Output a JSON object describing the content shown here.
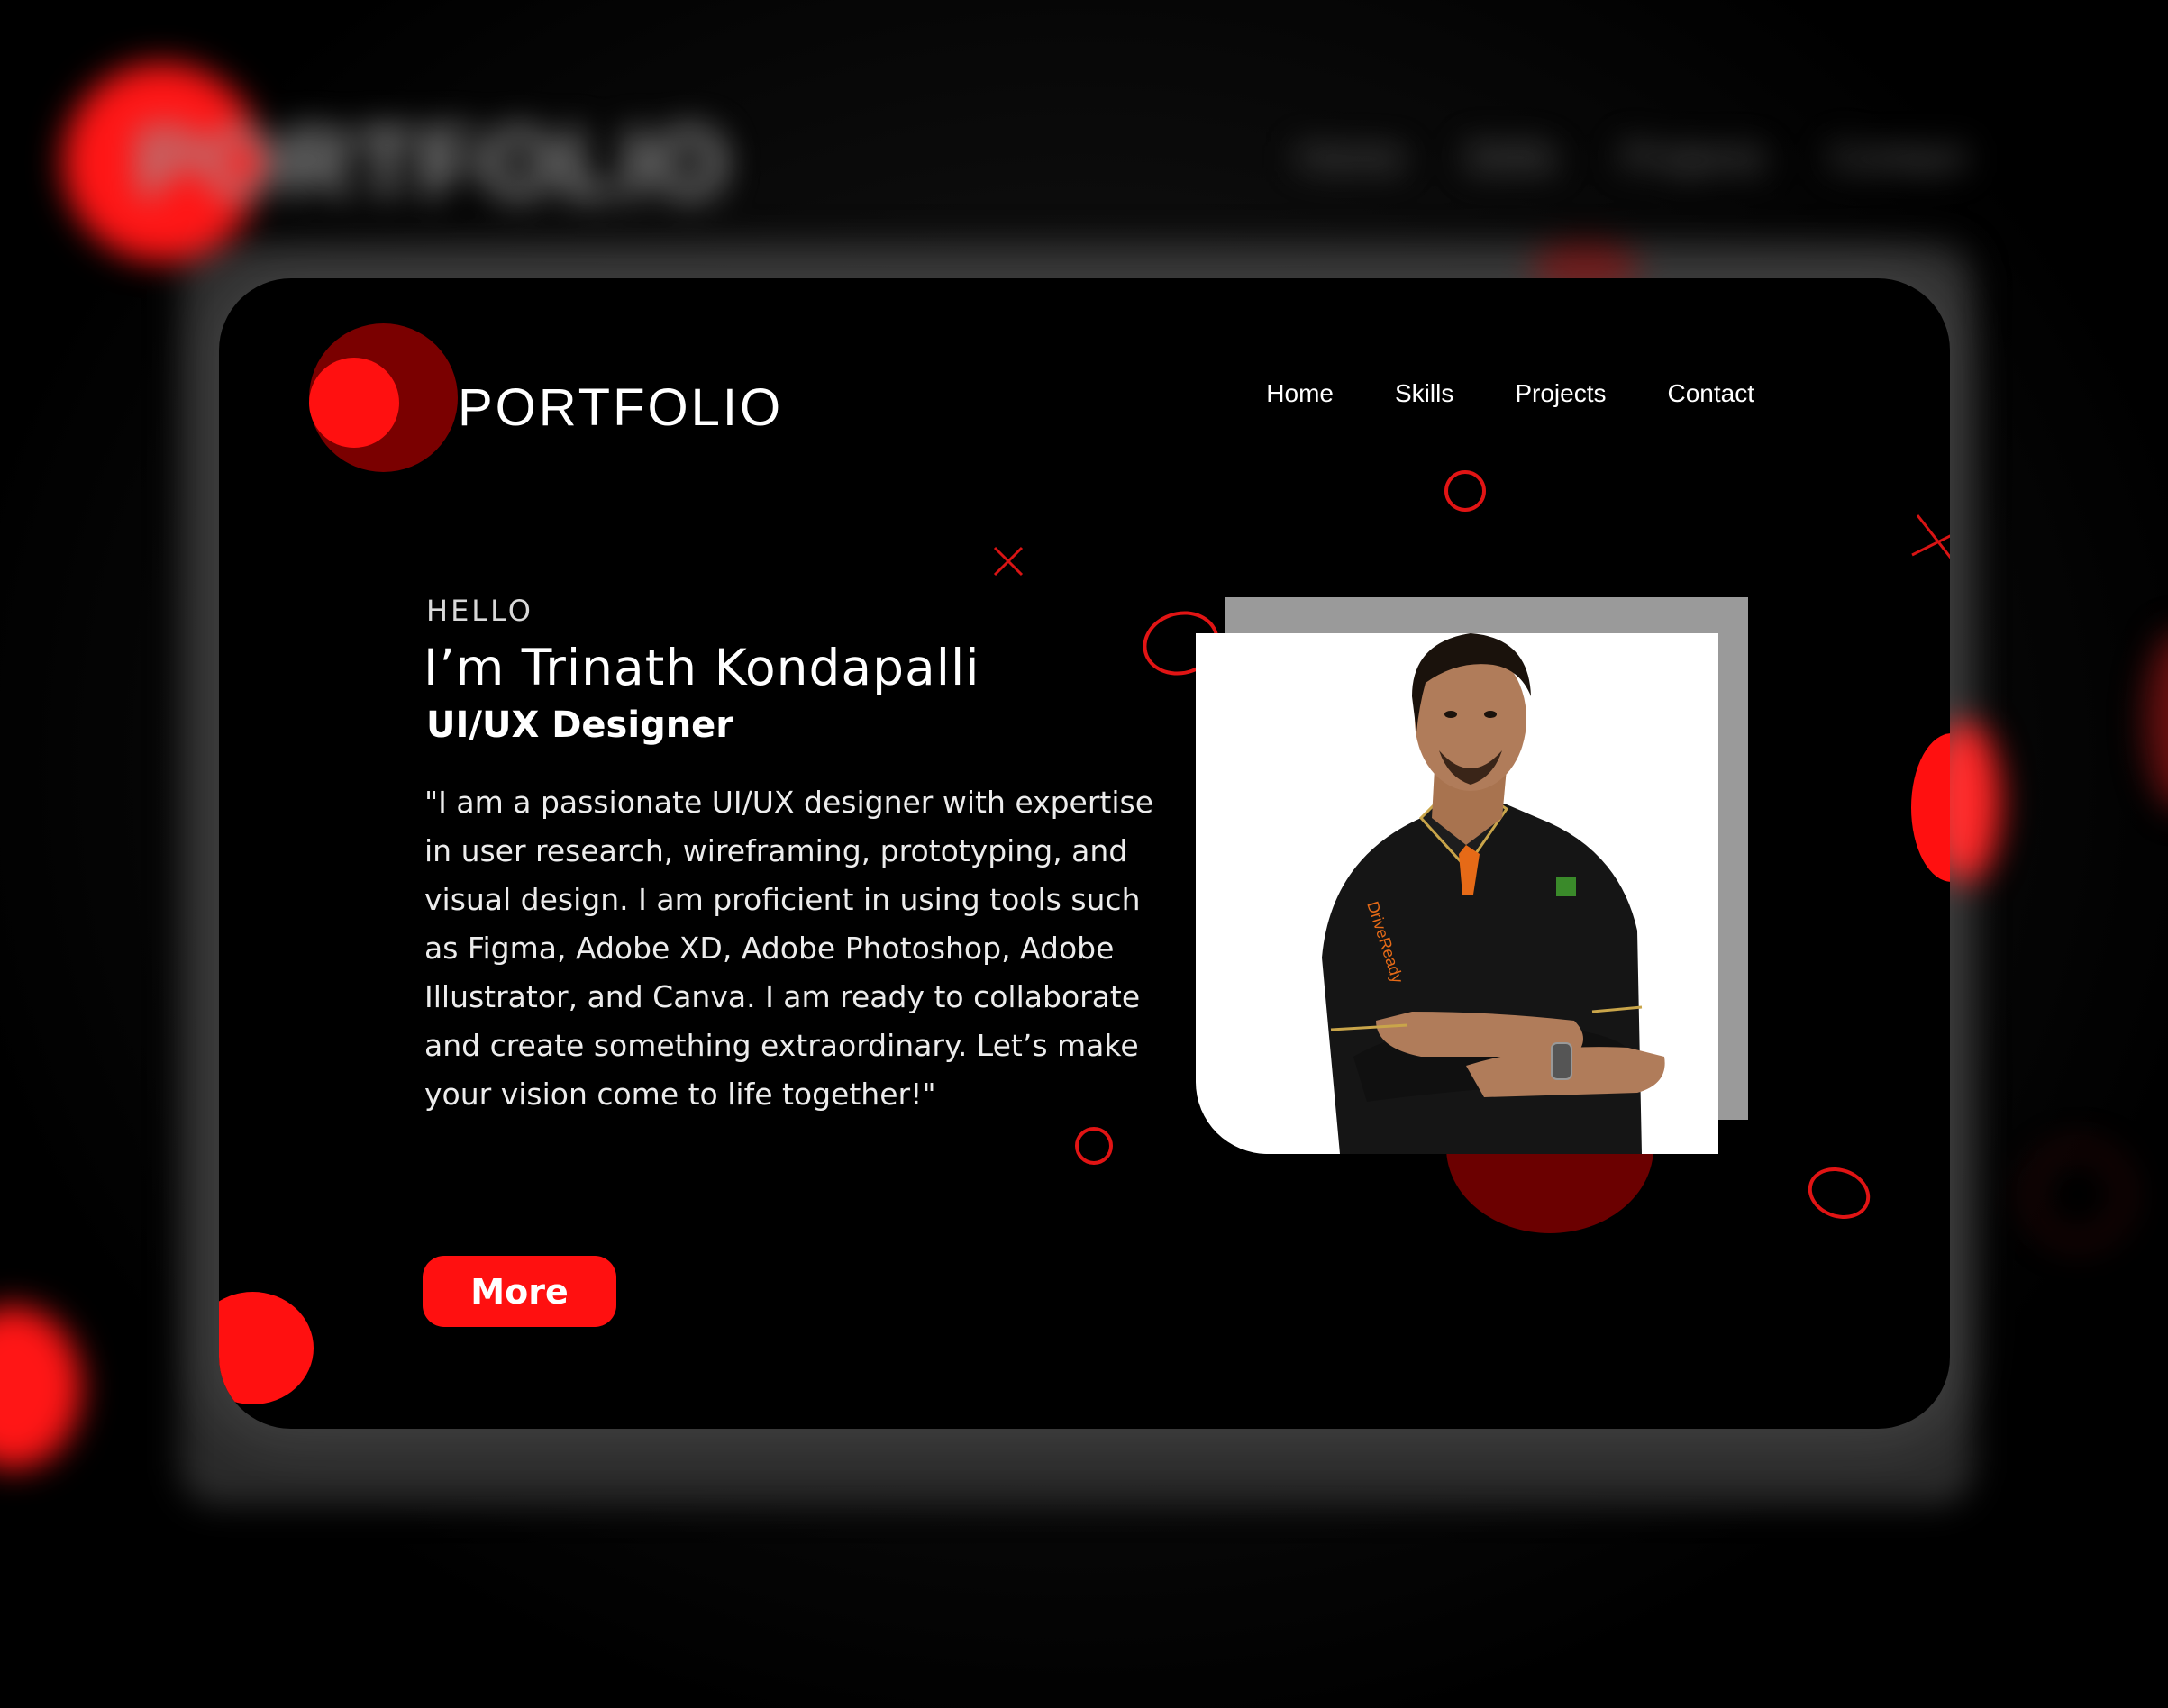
{
  "app": {
    "logo_text": "PORTFOLIO",
    "colors": {
      "accent": "#ff1010",
      "background": "#000000",
      "text": "#ffffff",
      "photo_backdrop": "#9a9a9a"
    }
  },
  "nav": {
    "items": [
      {
        "label": "Home"
      },
      {
        "label": "Skills"
      },
      {
        "label": "Projects"
      },
      {
        "label": "Contact"
      }
    ]
  },
  "hero": {
    "greeting": "HELLO",
    "name": "I’m Trinath Kondapalli",
    "role": "UI/UX Designer",
    "bio": "\"I am a passionate UI/UX designer with expertise in user research, wireframing, prototyping, and visual design. I am proficient in using tools such as Figma, Adobe XD, Adobe Photoshop, Adobe Illustrator, and Canva. I am ready to collaborate and create something extraordinary. Let’s make your vision come to life together!\"",
    "cta_label": "More"
  },
  "icons": {
    "logo_mark": "red-circle-logo-icon",
    "decor_cross": "cross-icon",
    "decor_ring": "ring-icon"
  }
}
